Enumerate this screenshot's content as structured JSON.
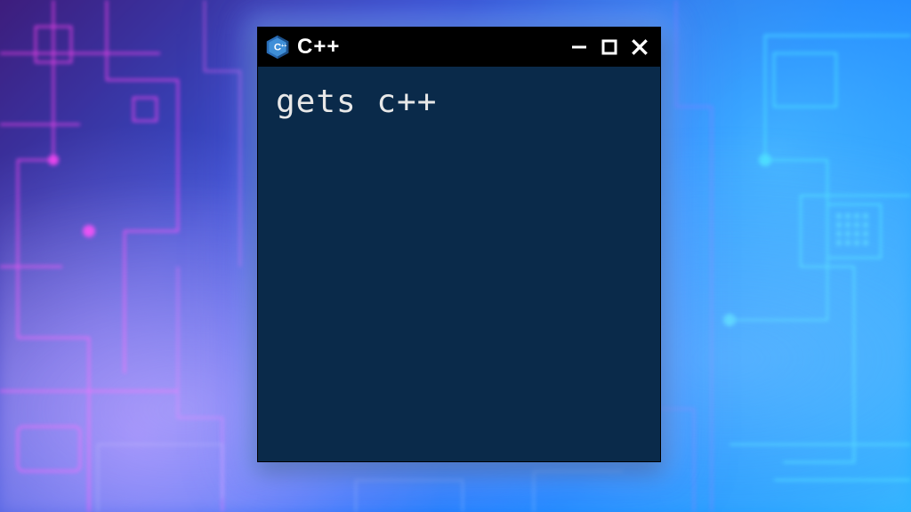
{
  "window": {
    "title": "C++",
    "icon_letter": "C",
    "icon_plus": "++"
  },
  "content": {
    "line1": "gets c++"
  }
}
